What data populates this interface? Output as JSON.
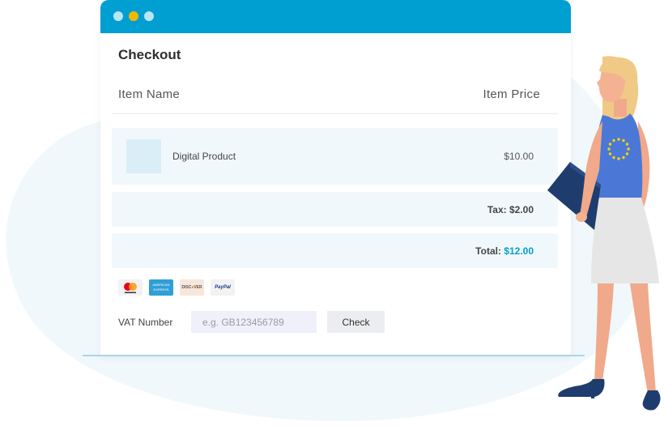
{
  "window": {
    "title": "Checkout"
  },
  "table": {
    "col_item_name": "Item Name",
    "col_item_price": "Item Price"
  },
  "item": {
    "name": "Digital Product",
    "price": "$10.00"
  },
  "tax": {
    "label": "Tax:",
    "value": "$2.00"
  },
  "total": {
    "label": "Total:",
    "value": "$12.00"
  },
  "payment_icons": [
    "mastercard-icon",
    "american-express-icon",
    "discover-icon",
    "paypal-icon"
  ],
  "vat": {
    "label": "VAT Number",
    "placeholder": "e.g. GB123456789",
    "value": "",
    "check_label": "Check"
  },
  "colors": {
    "accent": "#009fd1",
    "titlebar": "#009fd1",
    "row_bg": "#f1f8fb"
  }
}
